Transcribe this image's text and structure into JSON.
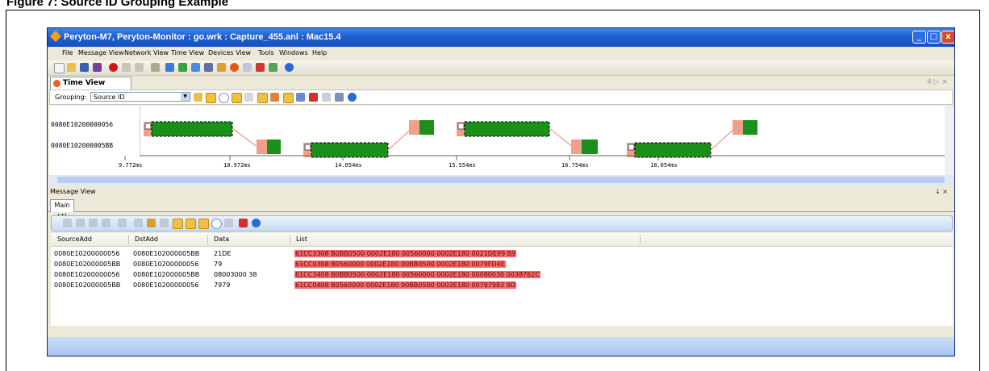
{
  "figure_caption": "Figure 7: Source ID Grouping Example",
  "window": {
    "title": "Peryton-M7, Peryton-Monitor : go.wrk : Capture_455.anl :  Mac15.4",
    "controls": [
      "_",
      "□",
      "x"
    ]
  },
  "menu": [
    "File",
    "Message View",
    "Network View",
    "Time View",
    "Devices View",
    "Tools",
    "Windows",
    "Help"
  ],
  "time_view": {
    "tab_label": "Time View",
    "tab_controls": "4 ▷ ×",
    "grouping_label": "Grouping:",
    "grouping_value": "Source ID",
    "rows": [
      "0080E10200000056",
      "0080E102000005BB"
    ],
    "ticks": [
      "9.772ms",
      "10.972ms",
      "14.054ms",
      "15.554ms",
      "16.754ms",
      "18.054ms"
    ]
  },
  "message_view": {
    "title": "Message View",
    "controls": "↓ ×",
    "tab": "Main [4]",
    "columns": [
      "SourceAdd",
      "DstAdd",
      "Data",
      "List"
    ],
    "rows": [
      {
        "src": "0080E10200000056",
        "dst": "0080E102000005BB",
        "data": "21DE",
        "list": "61CC3308 B0BB0500 0002E180 00560000 0002E180 0021DE99 B9"
      },
      {
        "src": "0080E102000005BB",
        "dst": "0080E10200000056",
        "data": "79",
        "list": "61CC0308 B0560000 0002E180 00BB0500 0002E180 0079FD4E"
      },
      {
        "src": "0080E10200000056",
        "dst": "0080E102000005BB",
        "data": "08003000 38",
        "list": "61CC3408 B0BB0500 0002E180 00560000 0002E180 00080030 0038762C"
      },
      {
        "src": "0080E102000005BB",
        "dst": "0080E10200000056",
        "data": "7979",
        "list": "61CC0408 B0560000 0002E180 00BB0500 0002E180 00797983 9D"
      }
    ]
  },
  "colors": {
    "frame_green": "#1a8f1a",
    "frame_salmon": "#f0a08a",
    "list_highlight": "#f06a6a",
    "titlebar": "#1f5fd1"
  }
}
